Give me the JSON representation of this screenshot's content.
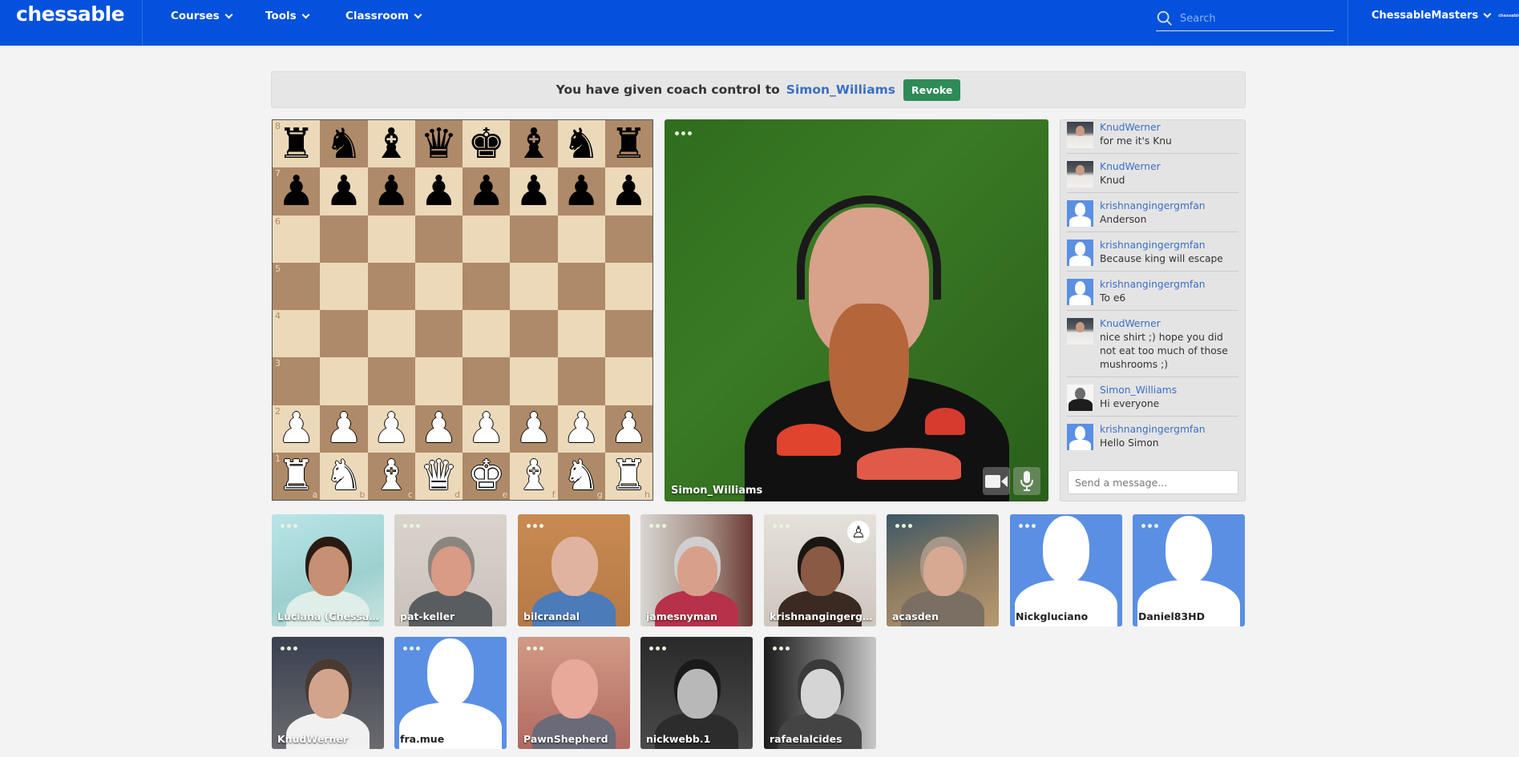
{
  "nav": {
    "logo": "chessable",
    "menus": [
      {
        "label": "Courses",
        "icon": "chevron-down-icon"
      },
      {
        "label": "Tools",
        "icon": "chevron-down-icon"
      },
      {
        "label": "Classroom",
        "icon": "chevron-down-icon"
      }
    ],
    "search": {
      "placeholder": "Search",
      "value": "",
      "icon": "search-icon"
    },
    "user": {
      "name": "ChessableMasters",
      "icon": "chevron-down-icon",
      "brand_badge": "chessable"
    },
    "colors": {
      "nav_bg": "#0351dc"
    }
  },
  "banner": {
    "text": "You have given coach control to",
    "coach": "Simon_Williams",
    "revoke_label": "Revoke",
    "colors": {
      "revoke_bg": "#2e8a57",
      "link": "#3a6fc4"
    }
  },
  "board": {
    "ranks": [
      "8",
      "7",
      "6",
      "5",
      "4",
      "3",
      "2",
      "1"
    ],
    "files": [
      "a",
      "b",
      "c",
      "d",
      "e",
      "f",
      "g",
      "h"
    ],
    "position": [
      [
        "r",
        "n",
        "b",
        "q",
        "k",
        "b",
        "n",
        "r"
      ],
      [
        "p",
        "p",
        "p",
        "p",
        "p",
        "p",
        "p",
        "p"
      ],
      [
        "",
        "",
        "",
        "",
        "",
        "",
        "",
        ""
      ],
      [
        "",
        "",
        "",
        "",
        "",
        "",
        "",
        ""
      ],
      [
        "",
        "",
        "",
        "",
        "",
        "",
        "",
        ""
      ],
      [
        "",
        "",
        "",
        "",
        "",
        "",
        "",
        ""
      ],
      [
        "P",
        "P",
        "P",
        "P",
        "P",
        "P",
        "P",
        "P"
      ],
      [
        "R",
        "N",
        "B",
        "Q",
        "K",
        "B",
        "N",
        "R"
      ]
    ],
    "colors": {
      "light": "#ecd9b9",
      "dark": "#ae8a68"
    }
  },
  "main_video": {
    "name": "Simon_Williams",
    "menu_icon": "more-dots-icon",
    "controls": [
      {
        "name": "camera-toggle",
        "icon": "video-camera-icon"
      },
      {
        "name": "mic-toggle",
        "icon": "microphone-icon"
      }
    ]
  },
  "chat": {
    "messages": [
      {
        "user": "KnudWerner",
        "text": "for me it's Knu",
        "avatar": "photo-knud"
      },
      {
        "user": "KnudWerner",
        "text": "Knud",
        "avatar": "photo-knud"
      },
      {
        "user": "krishnangingergmfan",
        "text": "Anderson",
        "avatar": "default"
      },
      {
        "user": "krishnangingergmfan",
        "text": "Because king will escape",
        "avatar": "default"
      },
      {
        "user": "krishnangingergmfan",
        "text": "To e6",
        "avatar": "default"
      },
      {
        "user": "KnudWerner",
        "text": "nice shirt ;) hope you did not eat too much of those mushrooms ;)",
        "avatar": "photo-knud"
      },
      {
        "user": "Simon_Williams",
        "text": "Hi everyone",
        "avatar": "photo-simon"
      },
      {
        "user": "krishnangingergmfan",
        "text": "Hello Simon",
        "avatar": "default"
      }
    ],
    "input": {
      "placeholder": "Send a message...",
      "value": ""
    }
  },
  "participants": [
    {
      "name": "Luciana (Chessable...",
      "type": "video"
    },
    {
      "name": "pat-keller",
      "type": "video"
    },
    {
      "name": "bilcrandal",
      "type": "video"
    },
    {
      "name": "jamesnyman",
      "type": "video"
    },
    {
      "name": "krishnangingergmf...",
      "type": "video",
      "badge": "pawn-icon"
    },
    {
      "name": "acasden",
      "type": "video"
    },
    {
      "name": "Nickgluciano",
      "type": "default"
    },
    {
      "name": "Daniel83HD",
      "type": "default"
    },
    {
      "name": "KnudWerner",
      "type": "video"
    },
    {
      "name": "fra.mue",
      "type": "default"
    },
    {
      "name": "PawnShepherd",
      "type": "video"
    },
    {
      "name": "nickwebb.1",
      "type": "video"
    },
    {
      "name": "rafaelalcides",
      "type": "video"
    }
  ]
}
